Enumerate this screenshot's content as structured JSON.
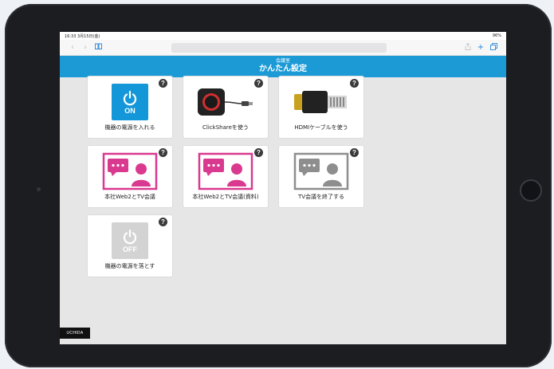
{
  "status_bar": {
    "time": "16:33 3月15日(金)",
    "battery": "96%"
  },
  "header": {
    "subtitle": "会議室",
    "title": "かんたん設定"
  },
  "tiles": [
    {
      "label": "機器の電源を入れる",
      "help": "?",
      "badge": "ON",
      "icon": "power-on-icon"
    },
    {
      "label": "ClickShareを使う",
      "help": "?",
      "icon": "clickshare-icon"
    },
    {
      "label": "HDMIケーブルを使う",
      "help": "?",
      "icon": "hdmi-cable-icon"
    },
    {
      "label": "本社Web2とTV会議",
      "help": "?",
      "icon": "video-call-icon"
    },
    {
      "label": "本社Web2とTV会議(資料)",
      "help": "?",
      "icon": "video-call-share-icon"
    },
    {
      "label": "TV会議を終了する",
      "help": "?",
      "icon": "video-call-end-icon"
    },
    {
      "label": "機器の電源を落とす",
      "help": "?",
      "badge": "OFF",
      "icon": "power-off-icon"
    }
  ],
  "footer": {
    "logo": "UCHIDA"
  },
  "colors": {
    "accent": "#1b9ad6",
    "magenta": "#d9398f",
    "gray": "#8e8e8e",
    "disabled": "#d3d3d3"
  }
}
